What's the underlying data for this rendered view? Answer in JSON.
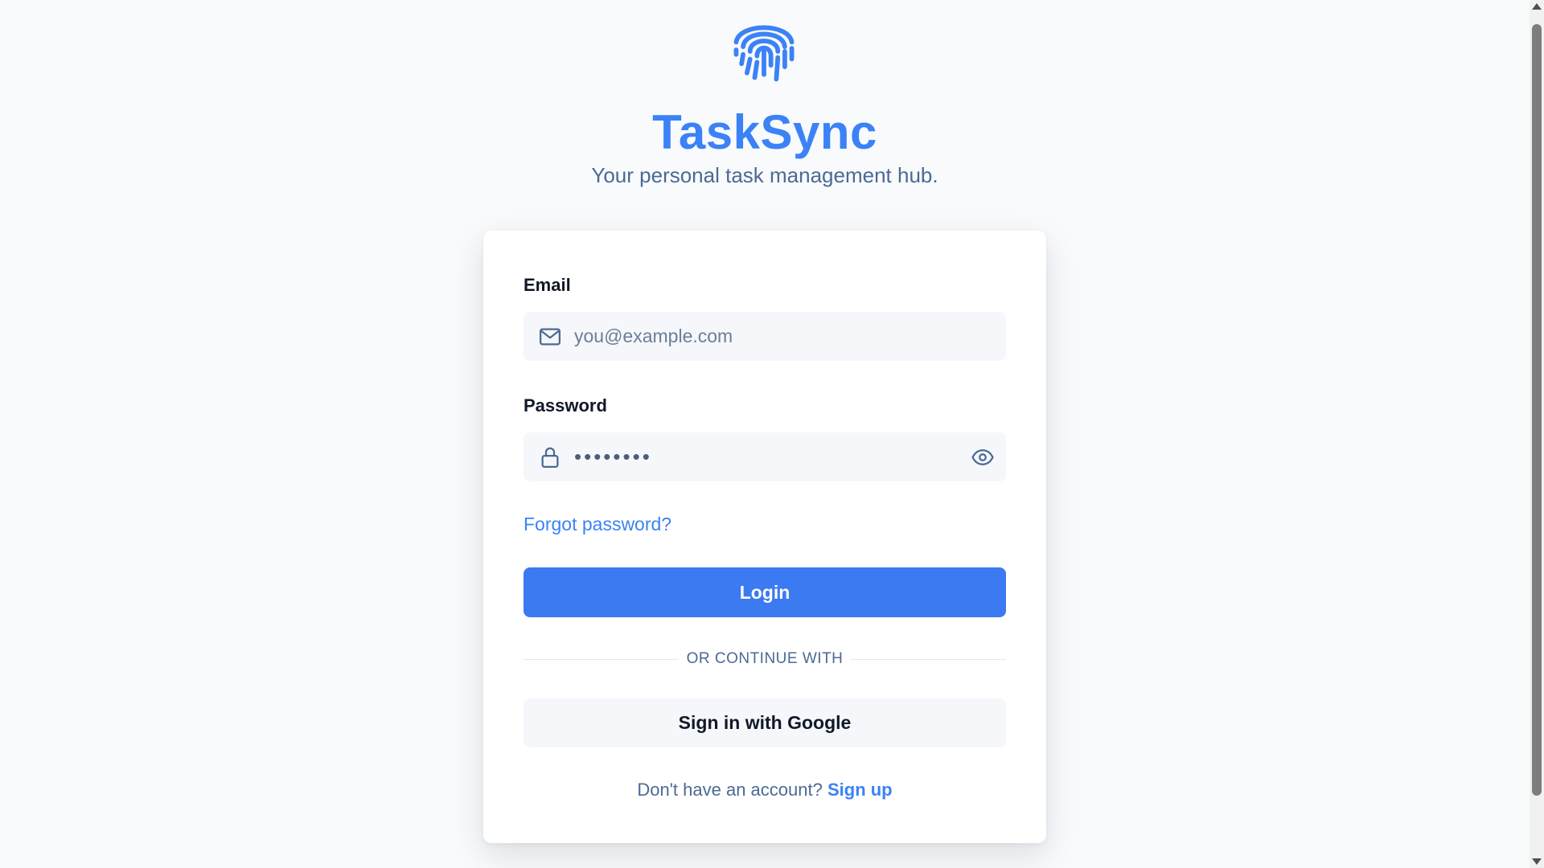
{
  "app": {
    "logo_icon": "fingerprint-icon",
    "title": "TaskSync",
    "tagline": "Your personal task management hub."
  },
  "login_form": {
    "email": {
      "label": "Email",
      "placeholder": "you@example.com",
      "value": "",
      "icon": "mail-icon"
    },
    "password": {
      "label": "Password",
      "value": "••••••••",
      "icon": "lock-icon",
      "toggle_icon": "eye-icon"
    },
    "forgot_password_label": "Forgot password?",
    "login_button_label": "Login",
    "divider_text": "OR CONTINUE WITH",
    "google_button_label": "Sign in with Google",
    "signup_prompt": "Don't have an account?",
    "signup_link_label": "Sign up"
  },
  "colors": {
    "accent": "#3b82f6",
    "button": "#3b7af1",
    "background": "#f8fafc",
    "muted_text": "#4b6a93"
  }
}
